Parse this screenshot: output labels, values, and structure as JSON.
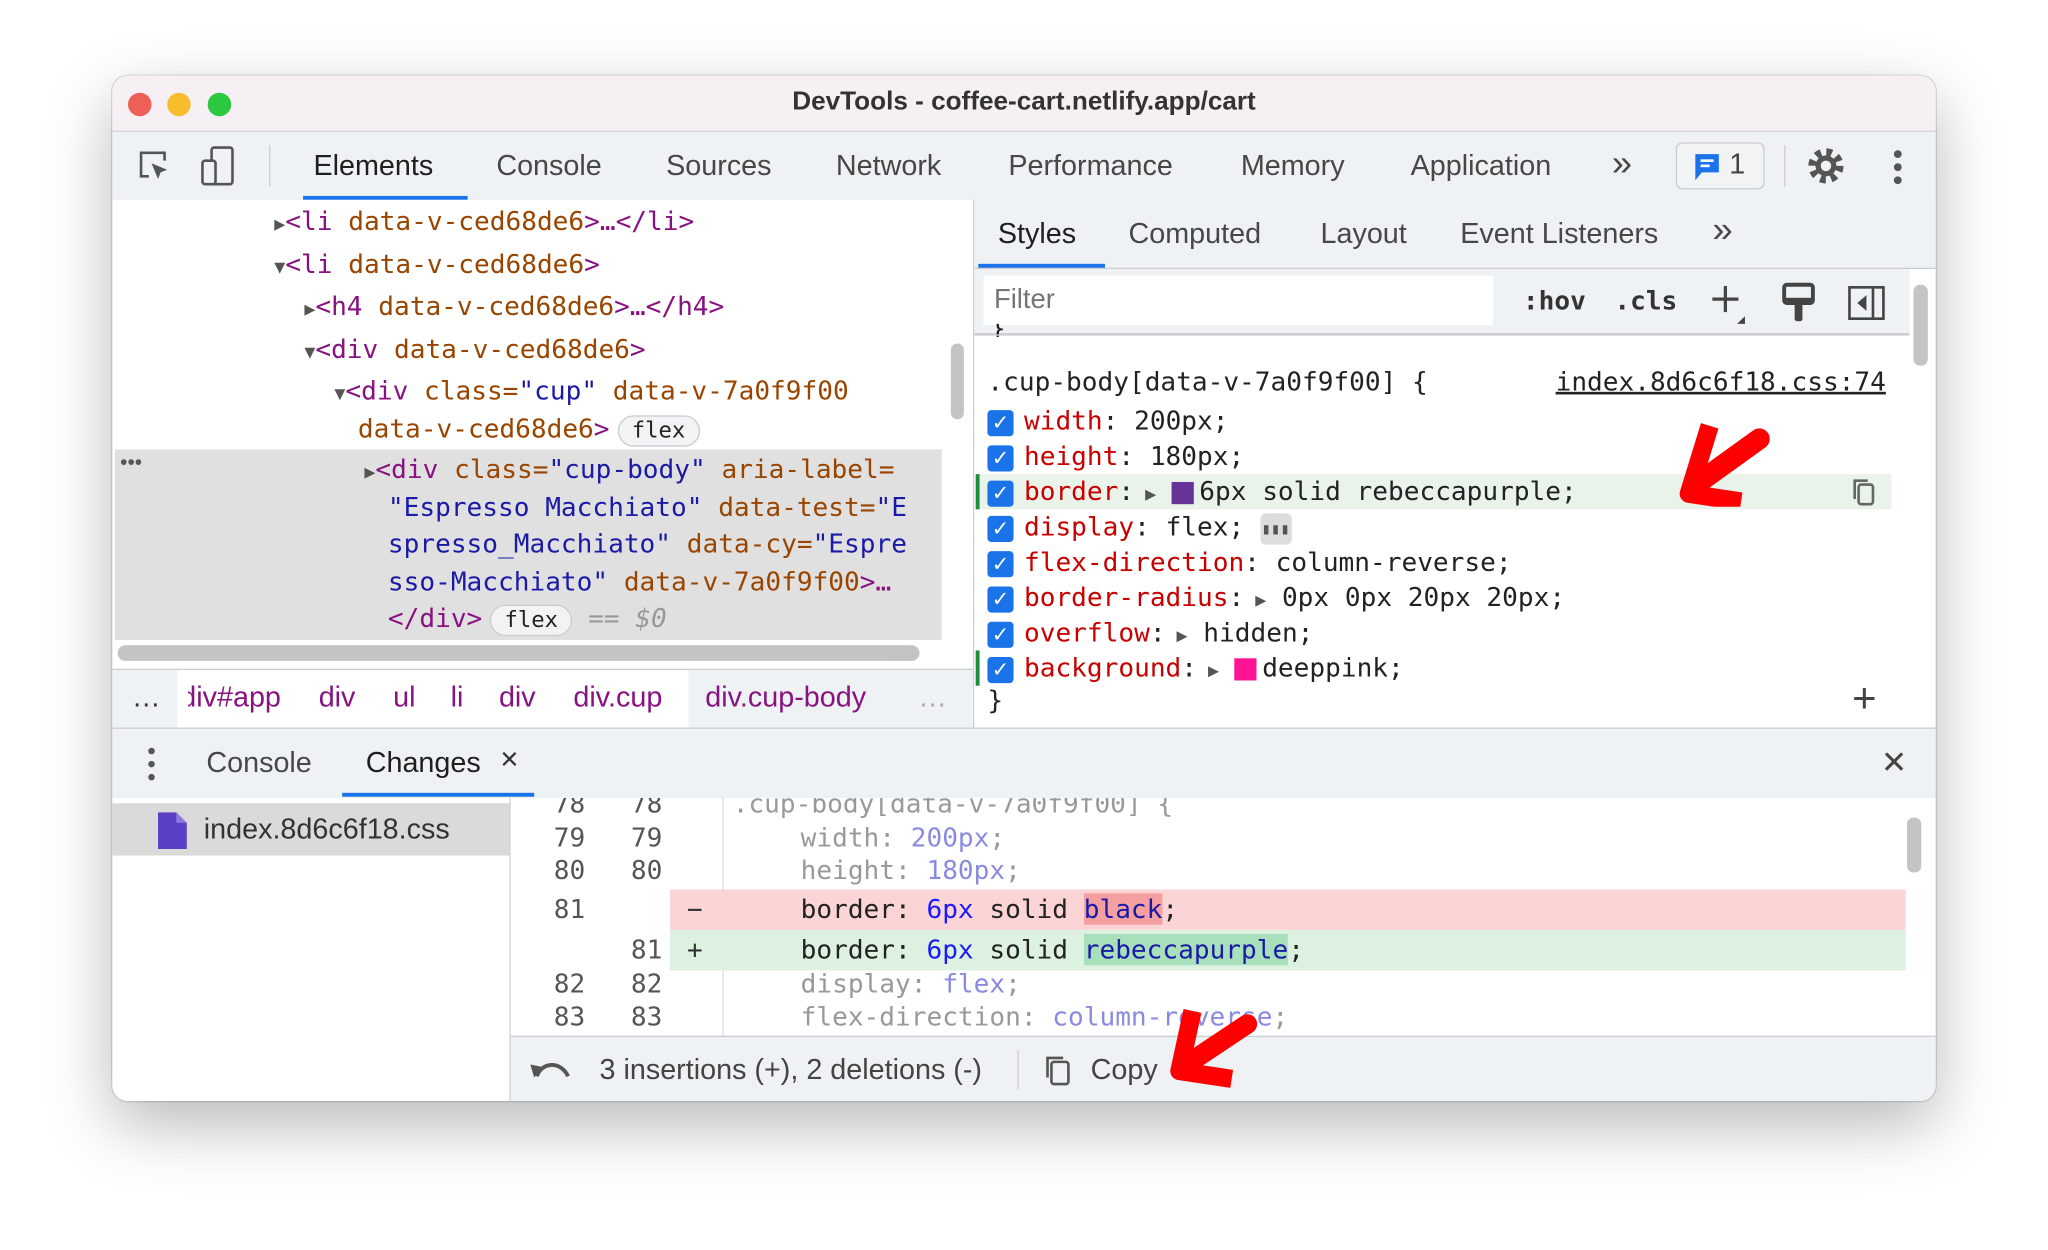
{
  "window": {
    "title": "DevTools - coffee-cart.netlify.app/cart"
  },
  "toolbar": {
    "tabs": [
      "Elements",
      "Console",
      "Sources",
      "Network",
      "Performance",
      "Memory",
      "Application"
    ],
    "active": "Elements",
    "more": "»",
    "issues_count": "1"
  },
  "elements": {
    "lines": [
      {
        "tag_open": "<li",
        "attrs": " data-v-ced68de6",
        "tail": ">…</li>"
      },
      {
        "tag_open": "<li",
        "attrs": " data-v-ced68de6",
        "tail": ">"
      },
      {
        "tag_open": "<h4",
        "attrs": " data-v-ced68de6",
        "tail": ">…</h4>"
      },
      {
        "tag_open": "<div",
        "attrs": " data-v-ced68de6",
        "tail": ">"
      }
    ],
    "cup_line1": {
      "tag": "<div",
      "a1": " class=",
      "v1": "\"cup\"",
      "a2": " data-v-7a0f9f00"
    },
    "cup_line2": {
      "a": "data-v-ced68de6",
      "t": ">",
      "badge": "flex"
    },
    "sel": {
      "l1": {
        "tag": "<div",
        "a1": " class=",
        "v1": "\"cup-body\"",
        "a2": " aria-label="
      },
      "l2": {
        "v": "\"Espresso Macchiato\"",
        "a": " data-test=",
        "v2": "\"E"
      },
      "l3": {
        "v": "spresso_Macchiato\"",
        "a": " data-cy=",
        "v2": "\"Espre"
      },
      "l4": {
        "v": "sso-Macchiato\"",
        "a": " data-v-7a0f9f00",
        "t": ">…"
      },
      "l5": {
        "t": "</div>",
        "badge": "flex",
        "eq": "== $0"
      },
      "dots": "•••"
    },
    "breadcrumbs": [
      "…",
      "div#app",
      "div",
      "ul",
      "li",
      "div",
      "div.cup",
      "div.cup-body",
      "…"
    ]
  },
  "styles": {
    "tabs": [
      "Styles",
      "Computed",
      "Layout",
      "Event Listeners"
    ],
    "more": "»",
    "active": "Styles",
    "filter_placeholder": "Filter",
    "hov": ":hov",
    "cls": ".cls",
    "selector": ".cup-body[data-v-7a0f9f00] {",
    "source": "index.8d6c6f18.css:74",
    "close": "}",
    "props": [
      {
        "name": "width",
        "value": "200px;"
      },
      {
        "name": "height",
        "value": "180px;"
      },
      {
        "name": "border",
        "value": "6px solid rebeccapurple;",
        "swatch": "#663399"
      },
      {
        "name": "display",
        "value": "flex;"
      },
      {
        "name": "flex-direction",
        "value": "column-reverse;"
      },
      {
        "name": "border-radius",
        "value": "0px 0px 20px 20px;"
      },
      {
        "name": "overflow",
        "value": "hidden;"
      },
      {
        "name": "background",
        "value": "deeppink;",
        "swatch": "#ff1493"
      }
    ]
  },
  "drawer": {
    "tabs": [
      "Console",
      "Changes"
    ],
    "active": "Changes",
    "close_tab": "×",
    "close": "✕",
    "file": "index.8d6c6f18.css",
    "diff": [
      {
        "old": "78",
        "new": "78",
        "mark": "",
        "text": ".cup-body[data-v-7a0f9f00] {",
        "type": "ctx"
      },
      {
        "old": "79",
        "new": "79",
        "mark": "",
        "p": "width: ",
        "v": "200px",
        "e": ";",
        "type": "ctx"
      },
      {
        "old": "80",
        "new": "80",
        "mark": "",
        "p": "height: ",
        "v": "180px",
        "e": ";",
        "type": "ctx"
      },
      {
        "old": "81",
        "new": "",
        "mark": "−",
        "p": "border: ",
        "v": "6px",
        "m": " solid ",
        "h": "black",
        "e": ";",
        "type": "del"
      },
      {
        "old": "",
        "new": "81",
        "mark": "+",
        "p": "border: ",
        "v": "6px",
        "m": " solid ",
        "h": "rebeccapurple",
        "e": ";",
        "type": "add"
      },
      {
        "old": "82",
        "new": "82",
        "mark": "",
        "p": "display: ",
        "v": "flex",
        "e": ";",
        "type": "ctx"
      },
      {
        "old": "83",
        "new": "83",
        "mark": "",
        "p": "flex-direction: ",
        "v": "column-reverse",
        "e": ";",
        "type": "ctx"
      }
    ],
    "summary": "3 insertions (+), 2 deletions (-)",
    "copy": "Copy"
  },
  "colors": {
    "accent": "#1a73e8",
    "annotation_arrow": "#ff0000",
    "deleted_bg": "#fbd5d5",
    "added_bg": "#dcf1e0"
  }
}
